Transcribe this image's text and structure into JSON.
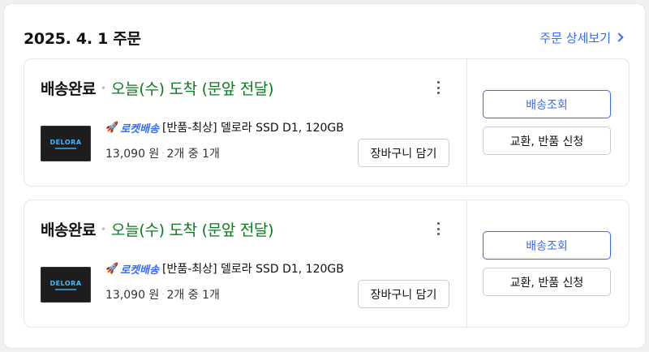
{
  "order": {
    "date": "2025. 4. 1 주문",
    "detail_link": "주문 상세보기"
  },
  "shipments": [
    {
      "status": "배송완료",
      "status_sub": "오늘(수) 도착 (문앞 전달)",
      "rocket_label": "로켓배송",
      "product_name": "[반품-최상] 델로라 SSD D1, 120GB",
      "price": "13,090 원",
      "quantity": "2개 중 1개",
      "thumb_brand": "DELORA",
      "cart_button": "장바구니 담기",
      "track_button": "배송조회",
      "return_button": "교환, 반품 신청"
    },
    {
      "status": "배송완료",
      "status_sub": "오늘(수) 도착 (문앞 전달)",
      "rocket_label": "로켓배송",
      "product_name": "[반품-최상] 델로라 SSD D1, 120GB",
      "price": "13,090 원",
      "quantity": "2개 중 1개",
      "thumb_brand": "DELORA",
      "cart_button": "장바구니 담기",
      "track_button": "배송조회",
      "return_button": "교환, 반품 신청"
    }
  ],
  "colors": {
    "accent": "#346aff",
    "status_green": "#0a7a1e"
  },
  "icons": {
    "rocket": "rocket-icon",
    "more": "more-vertical-icon",
    "chevron": "chevron-right-icon"
  }
}
